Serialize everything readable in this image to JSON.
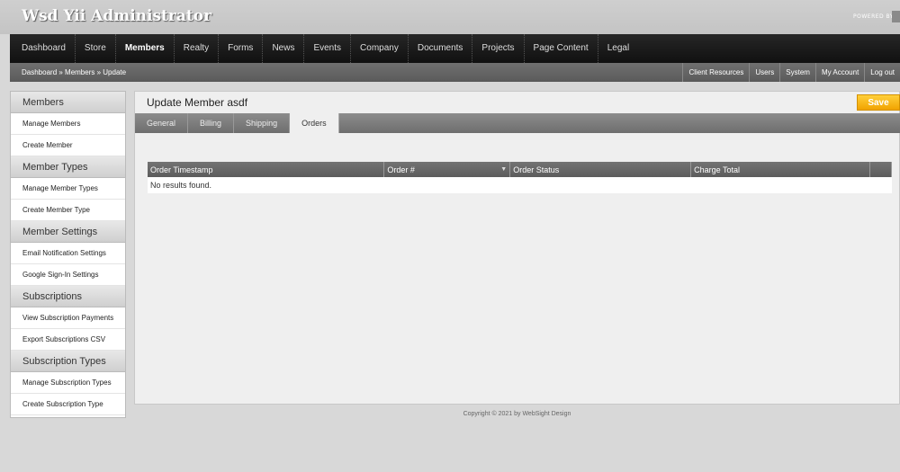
{
  "header": {
    "app_title": "Wsd Yii Administrator",
    "powered_by": "POWERED BY"
  },
  "main_nav": [
    {
      "label": "Dashboard",
      "active": false
    },
    {
      "label": "Store",
      "active": false
    },
    {
      "label": "Members",
      "active": true
    },
    {
      "label": "Realty",
      "active": false
    },
    {
      "label": "Forms",
      "active": false
    },
    {
      "label": "News",
      "active": false
    },
    {
      "label": "Events",
      "active": false
    },
    {
      "label": "Company",
      "active": false
    },
    {
      "label": "Documents",
      "active": false
    },
    {
      "label": "Projects",
      "active": false
    },
    {
      "label": "Page Content",
      "active": false
    },
    {
      "label": "Legal",
      "active": false
    }
  ],
  "sub_nav": {
    "breadcrumb": "Dashboard » Members » Update",
    "util_links": [
      "Client Resources",
      "Users",
      "System",
      "My Account",
      "Log out"
    ]
  },
  "sidebar": [
    {
      "header": "Members",
      "items": [
        "Manage Members",
        "Create Member"
      ]
    },
    {
      "header": "Member Types",
      "items": [
        "Manage Member Types",
        "Create Member Type"
      ]
    },
    {
      "header": "Member Settings",
      "items": [
        "Email Notification Settings",
        "Google Sign-In Settings"
      ]
    },
    {
      "header": "Subscriptions",
      "items": [
        "View Subscription Payments",
        "Export Subscriptions CSV"
      ]
    },
    {
      "header": "Subscription Types",
      "items": [
        "Manage Subscription Types",
        "Create Subscription Type"
      ]
    }
  ],
  "content": {
    "page_title": "Update Member asdf",
    "save_label": "Save",
    "tabs": [
      {
        "label": "General",
        "active": false
      },
      {
        "label": "Billing",
        "active": false
      },
      {
        "label": "Shipping",
        "active": false
      },
      {
        "label": "Orders",
        "active": true
      }
    ],
    "table": {
      "columns": [
        "Order Timestamp",
        "Order #",
        "Order Status",
        "Charge Total",
        ""
      ],
      "empty_message": "No results found."
    }
  },
  "footer": {
    "copyright": "Copyright © 2021 by WebSight Design"
  },
  "colors": {
    "accent_save": "#f1a300",
    "nav_bg": "#1a1a1a",
    "subnav_bg": "#666666"
  }
}
